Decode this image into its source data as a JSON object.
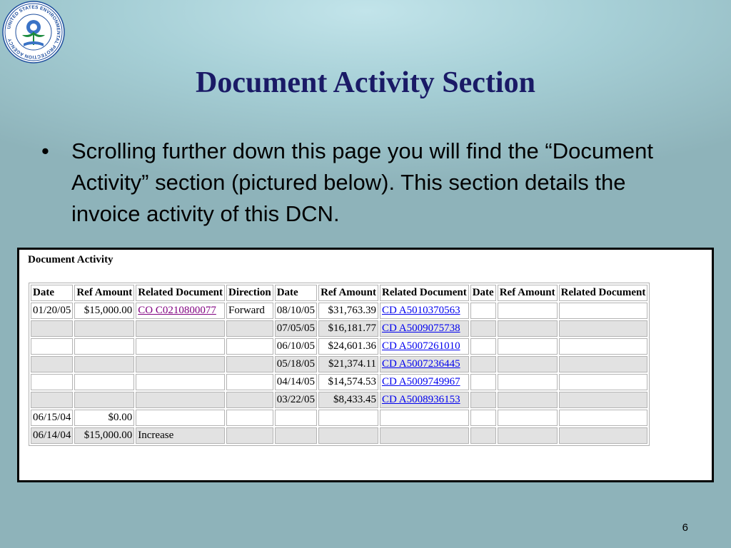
{
  "slide": {
    "title": "Document Activity Section",
    "bullet": "Scrolling further down this page you will find the “Document Activity” section (pictured below).  This section details the invoice activity of this DCN.",
    "page_number": "6",
    "logo_text": "UNITED STATES ENVIRONMENTAL PROTECTION AGENCY"
  },
  "panel": {
    "title": "Document Activity",
    "headers": [
      "Date",
      "Ref Amount",
      "Related Document",
      "Direction",
      "Date",
      "Ref Amount",
      "Related Document",
      "Date",
      "Ref Amount",
      "Related Document"
    ],
    "rows": [
      [
        "01/20/05",
        "$15,000.00",
        "CO C0210800077",
        "Forward",
        "08/10/05",
        "$31,763.39",
        "CD A5010370563",
        "",
        "",
        ""
      ],
      [
        "",
        "",
        "",
        "",
        "07/05/05",
        "$16,181.77",
        "CD A5009075738",
        "",
        "",
        ""
      ],
      [
        "",
        "",
        "",
        "",
        "06/10/05",
        "$24,601.36",
        "CD A5007261010",
        "",
        "",
        ""
      ],
      [
        "",
        "",
        "",
        "",
        "05/18/05",
        "$21,374.11",
        "CD A5007236445",
        "",
        "",
        ""
      ],
      [
        "",
        "",
        "",
        "",
        "04/14/05",
        "$14,574.53",
        "CD A5009749967",
        "",
        "",
        ""
      ],
      [
        "",
        "",
        "",
        "",
        "03/22/05",
        "$8,433.45",
        "CD A5008936153",
        "",
        "",
        ""
      ],
      [
        "06/15/04",
        "$0.00",
        "",
        "",
        "",
        "",
        "",
        "",
        "",
        ""
      ],
      [
        "06/14/04",
        "$15,000.00",
        "Increase",
        "",
        "",
        "",
        "",
        "",
        "",
        ""
      ]
    ]
  },
  "colors": {
    "title": "#1a1a66",
    "link": "#0000ee",
    "visited_link": "#800080",
    "row_shade": "#e2e2e2"
  }
}
